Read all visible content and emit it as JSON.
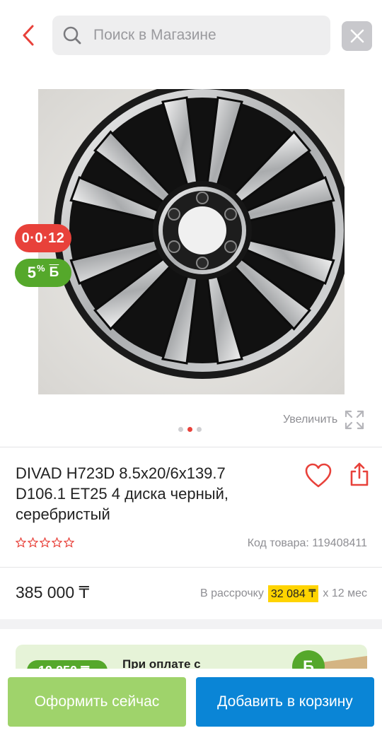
{
  "header": {
    "search_placeholder": "Поиск в Магазине",
    "back_icon": "chevron-left-icon",
    "close_icon": "close-icon"
  },
  "gallery": {
    "badge_installment": "0·0·12",
    "badge_bonus_percent": "5",
    "badge_bonus_sup": "%",
    "badge_bonus_letter": "Б",
    "zoom_label": "Увеличить",
    "slide_count": 3,
    "active_slide": 2
  },
  "product": {
    "title": "DIVAD H723D 8.5x20/6x139.7 D106.1 ET25 4 диска черный, серебристый",
    "rating": 0,
    "code": "Код товара: 119408411",
    "price": "385 000 ₸",
    "installment_label": "В рассрочку",
    "installment_amount": "32 084 ₸",
    "installment_term": "x 12 мес"
  },
  "promo": {
    "amount": "19 250 ₸",
    "text": "При оплате с",
    "coin_letter": "Б"
  },
  "actions": {
    "checkout_label": "Оформить сейчас",
    "cart_label": "Добавить в корзину"
  },
  "colors": {
    "accent_red": "#e8413a",
    "bonus_green": "#55a82b",
    "cart_blue": "#0a85d6",
    "checkout_green": "#9fd36b",
    "installment_yellow": "#ffd400"
  }
}
